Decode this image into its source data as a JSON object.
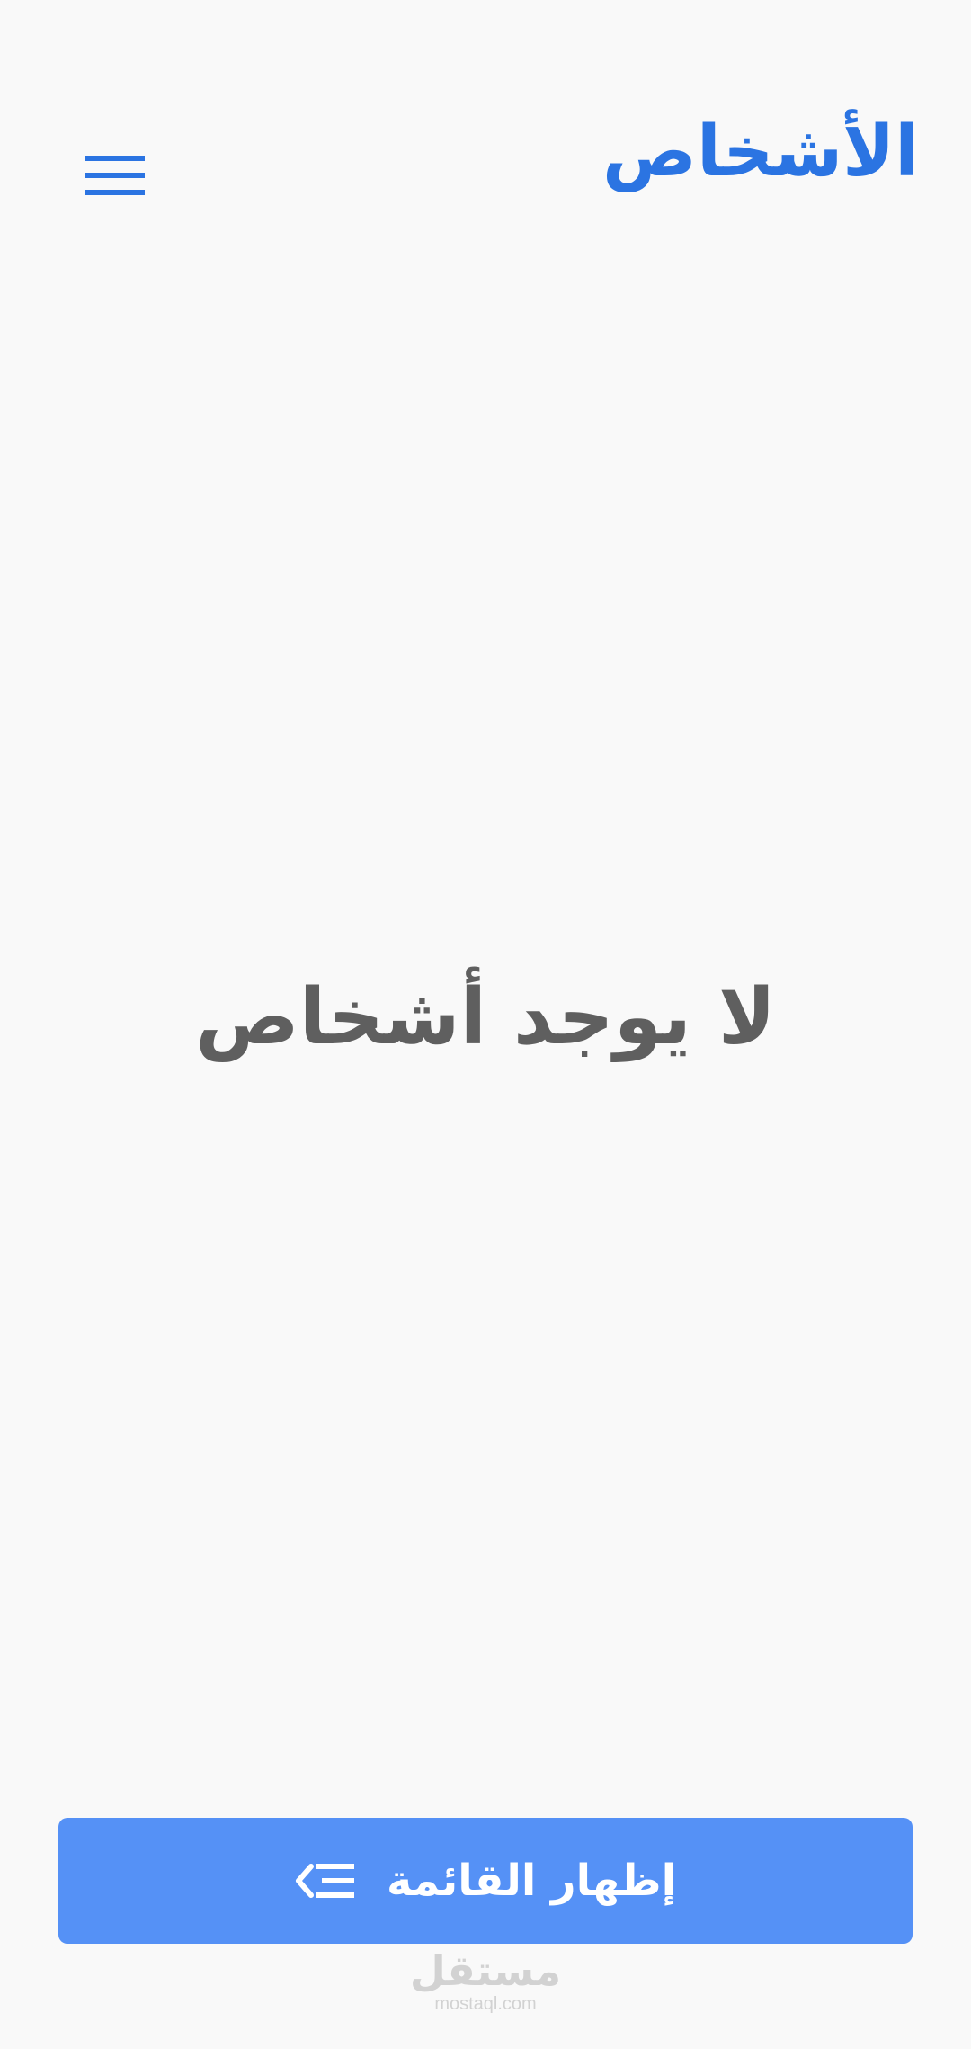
{
  "header": {
    "title": "الأشخاص",
    "menu_icon": "hamburger-menu-icon"
  },
  "main": {
    "empty_message": "لا يوجد أشخاص"
  },
  "footer": {
    "show_list_label": "إظهار القائمة",
    "show_list_icon": "list-collapse-icon"
  },
  "watermark": {
    "main": "مستقل",
    "sub": "mostaql.com"
  },
  "colors": {
    "background": "#f9f9f9",
    "accent": "#2b74e2",
    "button": "#5591f6",
    "empty_text": "#5f5f5f"
  }
}
